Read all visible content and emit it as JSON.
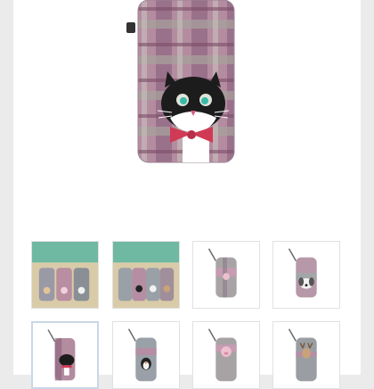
{
  "product": {
    "main_image": {
      "icon": "cat-phone-case-image"
    },
    "zoom_icon": "zoom-icon"
  },
  "thumbnails": [
    {
      "name": "thumb-group-photo-1",
      "icon": "cases-on-table-image",
      "selected": false
    },
    {
      "name": "thumb-group-photo-2",
      "icon": "cases-on-table-image",
      "selected": false
    },
    {
      "name": "thumb-pink-case",
      "icon": "case-image",
      "selected": false
    },
    {
      "name": "thumb-dog-case",
      "icon": "case-image",
      "selected": false
    },
    {
      "name": "thumb-cat-case",
      "icon": "case-image",
      "selected": true
    },
    {
      "name": "thumb-penguin-case",
      "icon": "case-image",
      "selected": false
    },
    {
      "name": "thumb-pig-case",
      "icon": "case-image",
      "selected": false
    },
    {
      "name": "thumb-deer-case",
      "icon": "case-image",
      "selected": false
    }
  ],
  "colors": {
    "plaid_pink": "#b58aa0",
    "plaid_plum": "#8a5c78",
    "plaid_grey": "#a6a09c",
    "cat_black": "#1c1c1c",
    "bow_red": "#d03a55",
    "selected_border": "#c9d7e6"
  }
}
